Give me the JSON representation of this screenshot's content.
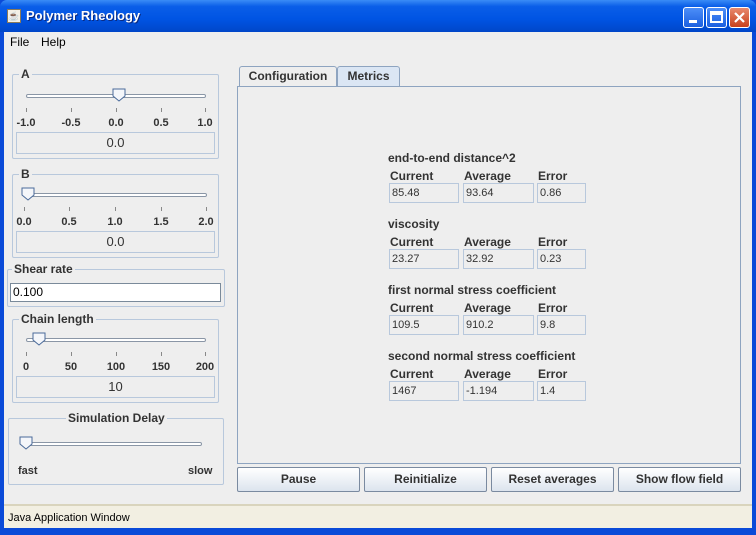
{
  "window": {
    "title": "Polymer Rheology"
  },
  "menu": [
    {
      "label": "File"
    },
    {
      "label": "Help"
    }
  ],
  "left": {
    "a": {
      "label": "A",
      "ticks": [
        "-1.0",
        "-0.5",
        "0.0",
        "0.5",
        "1.0"
      ],
      "value": "0.0",
      "slider_level": 0.5
    },
    "b": {
      "label": "B",
      "ticks": [
        "0.0",
        "0.5",
        "1.0",
        "1.5",
        "2.0"
      ],
      "value": "0.0",
      "slider_level": 0.0
    },
    "shear": {
      "label": "Shear rate",
      "value": "0.100"
    },
    "chain": {
      "label": "Chain length",
      "ticks": [
        "0",
        "50",
        "100",
        "150",
        "200"
      ],
      "value": "10",
      "slider_level": 0.05
    },
    "delay": {
      "label": "Simulation Delay",
      "min_label": "fast",
      "max_label": "slow",
      "slider_level": 0.0
    }
  },
  "tabs": [
    {
      "label": "Configuration"
    },
    {
      "label": "Metrics"
    }
  ],
  "active_tab": "Metrics",
  "metrics": [
    {
      "title": "end-to-end distance^2",
      "current": "85.48",
      "average": "93.64",
      "error": "0.86"
    },
    {
      "title": "viscosity",
      "current": "23.27",
      "average": "32.92",
      "error": "0.23"
    },
    {
      "title": "first normal stress coefficient",
      "current": "109.5",
      "average": "910.2",
      "error": "9.8"
    },
    {
      "title": "second normal stress coefficient",
      "current": "1467",
      "average": "-1.194",
      "error": "1.4"
    }
  ],
  "metric_headers": {
    "current": "Current",
    "average": "Average",
    "error": "Error"
  },
  "buttons": [
    {
      "label": "Pause"
    },
    {
      "label": "Reinitialize"
    },
    {
      "label": "Reset averages"
    },
    {
      "label": "Show flow field"
    }
  ],
  "status": {
    "text": "Java Application Window"
  },
  "colors": {
    "title_bar": "#0054e3",
    "panel_border": "#b8c8dc",
    "background": "#eeeeee"
  }
}
